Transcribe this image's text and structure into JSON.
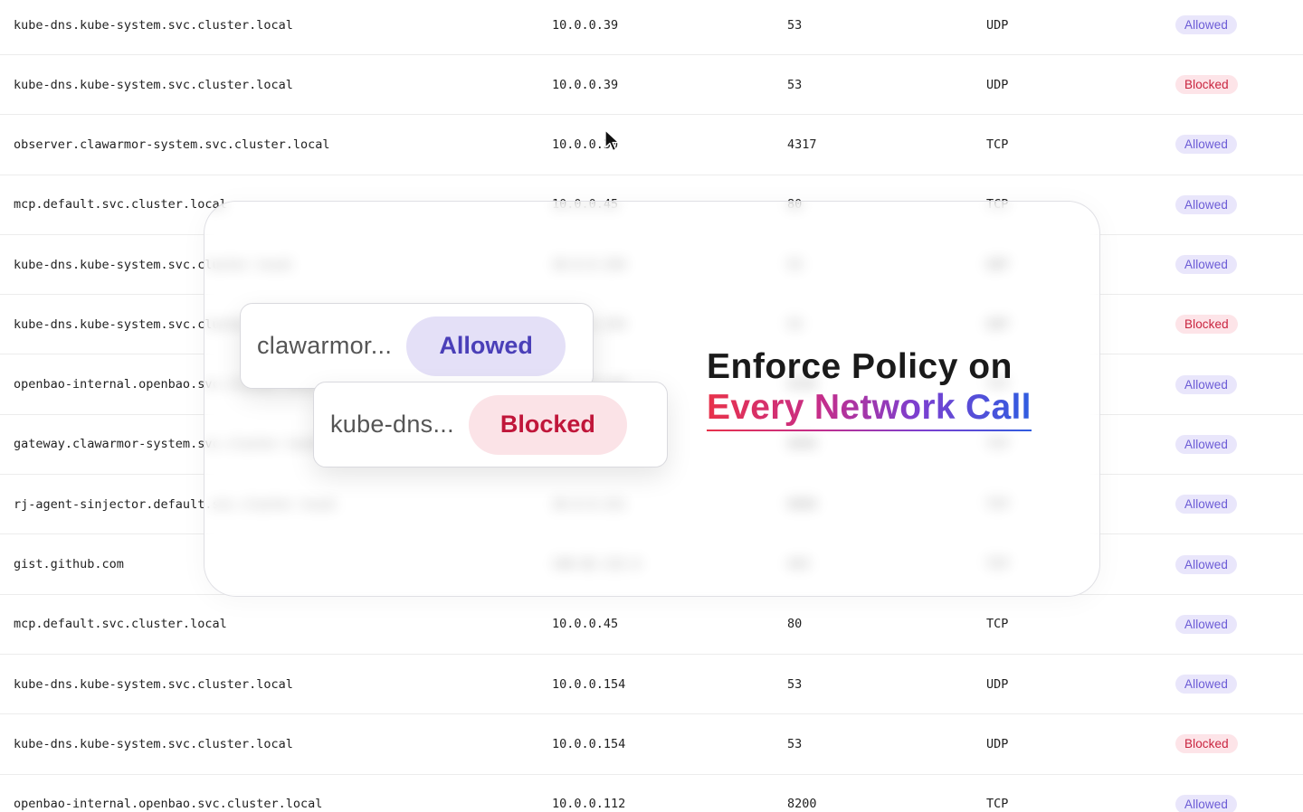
{
  "rows": [
    {
      "host": "kube-dns.kube-system.svc.cluster.local",
      "ip": "10.0.0.39",
      "port": "53",
      "proto": "UDP",
      "status": "Allowed"
    },
    {
      "host": "kube-dns.kube-system.svc.cluster.local",
      "ip": "10.0.0.39",
      "port": "53",
      "proto": "UDP",
      "status": "Blocked"
    },
    {
      "host": "observer.clawarmor-system.svc.cluster.local",
      "ip": "10.0.0.30",
      "port": "4317",
      "proto": "TCP",
      "status": "Allowed"
    },
    {
      "host": "mcp.default.svc.cluster.local",
      "ip": "10.0.0.45",
      "port": "80",
      "proto": "TCP",
      "status": "Allowed"
    },
    {
      "host": "kube-dns.kube-system.svc.cluster.local",
      "ip": "10.0.0.154",
      "port": "53",
      "proto": "UDP",
      "status": "Allowed"
    },
    {
      "host": "kube-dns.kube-system.svc.cluster.local",
      "ip": "10.0.0.154",
      "port": "53",
      "proto": "UDP",
      "status": "Blocked"
    },
    {
      "host": "openbao-internal.openbao.svc.cluster.local",
      "ip": "10.0.0.112",
      "port": "8200",
      "proto": "TCP",
      "status": "Allowed"
    },
    {
      "host": "gateway.clawarmor-system.svc.cluster.local",
      "ip": "10.0.0.101",
      "port": "8080",
      "proto": "TCP",
      "status": "Allowed"
    },
    {
      "host": "rj-agent-sinjector.default.svc.cluster.local",
      "ip": "10.0.0.211",
      "port": "8080",
      "proto": "TCP",
      "status": "Allowed"
    },
    {
      "host": "gist.github.com",
      "ip": "140.82.113.4",
      "port": "443",
      "proto": "TCP",
      "status": "Allowed"
    },
    {
      "host": "mcp.default.svc.cluster.local",
      "ip": "10.0.0.45",
      "port": "80",
      "proto": "TCP",
      "status": "Allowed"
    },
    {
      "host": "kube-dns.kube-system.svc.cluster.local",
      "ip": "10.0.0.154",
      "port": "53",
      "proto": "UDP",
      "status": "Allowed"
    },
    {
      "host": "kube-dns.kube-system.svc.cluster.local",
      "ip": "10.0.0.154",
      "port": "53",
      "proto": "UDP",
      "status": "Blocked"
    },
    {
      "host": "openbao-internal.openbao.svc.cluster.local",
      "ip": "10.0.0.112",
      "port": "8200",
      "proto": "TCP",
      "status": "Allowed"
    }
  ],
  "overlay": {
    "card_one": {
      "host": "clawarmor...",
      "status": "Allowed"
    },
    "card_two": {
      "host": "kube-dns...",
      "status": "Blocked"
    },
    "headline_line1": "Enforce Policy on",
    "headline_line2": "Every Network Call"
  },
  "colors": {
    "allowed_bg": "#e9e6fb",
    "allowed_text": "#6b5bd6",
    "blocked_bg": "#fde4e8",
    "blocked_text": "#c9243f"
  }
}
